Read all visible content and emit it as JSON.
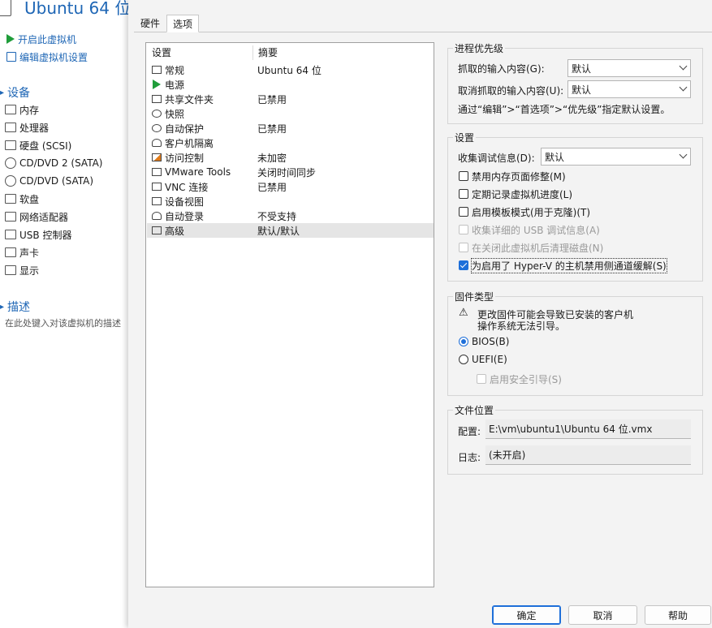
{
  "background": {
    "vm_title": "Ubuntu 64 位",
    "actions": [
      {
        "label": "开启此虚拟机",
        "icon": "play-icon"
      },
      {
        "label": "编辑虚拟机设置",
        "icon": "edit-settings-icon"
      }
    ],
    "devices_section": "设备",
    "devices": [
      {
        "label": "内存",
        "icon": "memory-icon"
      },
      {
        "label": "处理器",
        "icon": "cpu-icon"
      },
      {
        "label": "硬盘 (SCSI)",
        "icon": "hard-disk-icon"
      },
      {
        "label": "CD/DVD 2 (SATA)",
        "icon": "cd-dvd-icon"
      },
      {
        "label": "CD/DVD (SATA)",
        "icon": "cd-dvd-icon"
      },
      {
        "label": "软盘",
        "icon": "floppy-icon"
      },
      {
        "label": "网络适配器",
        "icon": "network-adapter-icon"
      },
      {
        "label": "USB 控制器",
        "icon": "usb-icon"
      },
      {
        "label": "声卡",
        "icon": "sound-card-icon"
      },
      {
        "label": "显示",
        "icon": "display-icon"
      }
    ],
    "description_section": "描述",
    "description_placeholder": "在此处键入对该虚拟机的描述"
  },
  "dialog": {
    "tabs": [
      {
        "label": "硬件",
        "active": false
      },
      {
        "label": "选项",
        "active": true
      }
    ],
    "list": {
      "col_setting": "设置",
      "col_summary": "摘要",
      "rows": [
        {
          "name": "常规",
          "value": "Ubuntu 64 位",
          "icon": "general-icon"
        },
        {
          "name": "电源",
          "value": "",
          "icon": "power-icon"
        },
        {
          "name": "共享文件夹",
          "value": "已禁用",
          "icon": "shared-folder-icon"
        },
        {
          "name": "快照",
          "value": "",
          "icon": "snapshot-icon"
        },
        {
          "name": "自动保护",
          "value": "已禁用",
          "icon": "autoprotect-icon"
        },
        {
          "name": "客户机隔离",
          "value": "",
          "icon": "guest-isolation-icon"
        },
        {
          "name": "访问控制",
          "value": "未加密",
          "icon": "access-control-icon"
        },
        {
          "name": "VMware Tools",
          "value": "关闭时间同步",
          "icon": "vmware-tools-icon"
        },
        {
          "name": "VNC 连接",
          "value": "已禁用",
          "icon": "vnc-icon"
        },
        {
          "name": "设备视图",
          "value": "",
          "icon": "device-view-icon"
        },
        {
          "name": "自动登录",
          "value": "不受支持",
          "icon": "autologin-icon"
        },
        {
          "name": "高级",
          "value": "默认/默认",
          "icon": "advanced-icon",
          "selected": true
        }
      ]
    },
    "priority": {
      "title": "进程优先级",
      "grab_label": "抓取的输入内容(G):",
      "grab_value": "默认",
      "ungrab_label": "取消抓取的输入内容(U):",
      "ungrab_value": "默认",
      "note": "通过“编辑”>“首选项”>“优先级”指定默认设置。"
    },
    "settings": {
      "title": "设置",
      "debug_label": "收集调试信息(D):",
      "debug_value": "默认",
      "options": [
        {
          "label": "禁用内存页面修整(M)",
          "checked": false,
          "disabled": false
        },
        {
          "label": "定期记录虚拟机进度(L)",
          "checked": false,
          "disabled": false
        },
        {
          "label": "启用模板模式(用于克隆)(T)",
          "checked": false,
          "disabled": false
        },
        {
          "label": "收集详细的 USB 调试信息(A)",
          "checked": false,
          "disabled": true
        },
        {
          "label": "在关闭此虚拟机后清理磁盘(N)",
          "checked": false,
          "disabled": true
        },
        {
          "label": "为启用了 Hyper-V 的主机禁用侧通道缓解(S)",
          "checked": true,
          "disabled": false
        }
      ]
    },
    "firmware": {
      "title": "固件类型",
      "warning_line1": "更改固件可能会导致已安装的客户机",
      "warning_line2": "操作系统无法引导。",
      "bios_label": "BIOS(B)",
      "uefi_label": "UEFI(E)",
      "selected": "BIOS",
      "secure_boot_label": "启用安全引导(S)"
    },
    "file_location": {
      "title": "文件位置",
      "config_label": "配置:",
      "config_value": "E:\\vm\\ubuntu1\\Ubuntu 64 位.vmx",
      "log_label": "日志:",
      "log_value": "(未开启)"
    },
    "buttons": {
      "ok": "确定",
      "cancel": "取消",
      "help": "帮助"
    }
  }
}
